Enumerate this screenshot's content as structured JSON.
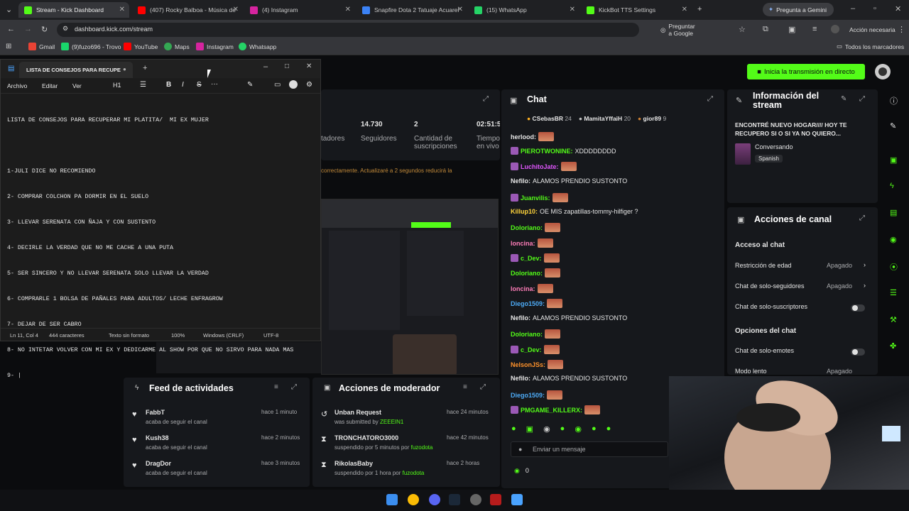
{
  "tabs": [
    {
      "label": "Stream - Kick Dashboard",
      "color": "#53fc18"
    },
    {
      "label": "(407) Rocky Balboa - Música de",
      "color": "#ff0000"
    },
    {
      "label": "(4) Instagram",
      "color": "#d6249f"
    },
    {
      "label": "Snapfire Dota 2 Tatuaje Acuarel",
      "color": "#3b82f6"
    },
    {
      "label": "(15) WhatsApp",
      "color": "#25d366"
    },
    {
      "label": "KickBot TTS Settings",
      "color": "#53fc18"
    }
  ],
  "gemini_label": "Pregunta a Gemini",
  "url": "dashboard.kick.com/stream",
  "ask_google": "Preguntar a Google",
  "action_needed": "Acción necesaria",
  "bookmarks": [
    "Gmail",
    "(9)fuzo696 - Trovo",
    "YouTube",
    "Maps",
    "Instagram",
    "Whatsapp"
  ],
  "all_bookmarks": "Todos los marcadores",
  "notepad": {
    "tab_title": "LISTA DE CONSEJOS PARA RECUPE",
    "menu": [
      "Archivo",
      "Editar",
      "Ver"
    ],
    "heading_style": "H1",
    "lines": [
      "LISTA DE CONSEJOS PARA RECUPERAR MI PLATITA/  MI EX MUJER",
      "",
      "1-JULI DICE NO RECOMIENDO",
      "2- COMPRAR COLCHON PA DORMIR EN EL SUELO",
      "3- LLEVAR SERENATA CON ÑAJA Y CON SUSTENTO",
      "4- DECIRLE LA VERDAD QUE NO ME CACHE A UNA PUTA",
      "5- SER SINCERO Y NO LLEVAR SERENATA SOLO LLEVAR LA VERDAD",
      "6- COMPRARLE 1 BOLSA DE PAÑALES PARA ADULTOS/ LECHE ENFRAGROW",
      "7- DEJAR DE SER CABRO",
      "8- NO INTETAR VOLVER CON MI EX Y DEDICARME AL SHOW POR QUE NO SIRVO PARA NADA MAS",
      "9- |"
    ],
    "status": [
      "Ln 11, Col 4",
      "444 caracteres",
      "Texto sin formato",
      "100%",
      "Windows (CRLF)",
      "UTF-8"
    ]
  },
  "go_live": "Inicia la transmisión en directo",
  "stats": {
    "col_label": "tadores",
    "followers_value": "14.730",
    "followers_label": "Seguidores",
    "subs_value": "2",
    "subs_label": "Cantidad de suscripciones",
    "time_value": "02:51:5",
    "time_label": "Tiempo en vivo"
  },
  "notice": "correctamente. Actualizaré a 2 segundos reducirá la",
  "chat": {
    "title": "Chat",
    "top": [
      {
        "name": "CSebasBR",
        "n": "24"
      },
      {
        "name": "MamitaYffaiH",
        "n": "20"
      },
      {
        "name": "gior89",
        "n": "9"
      }
    ],
    "messages": [
      {
        "user": "herlood:",
        "color": "#e6e6e6",
        "text": "",
        "emote": true
      },
      {
        "user": "PIEROTWONINE:",
        "color": "#53fc18",
        "text": "XDDDDDDDD",
        "emote": false
      },
      {
        "user": "LuchitoJate:",
        "color": "#e056fd",
        "text": "",
        "emote": true
      },
      {
        "user": "Nefilo:",
        "color": "#e6e6e6",
        "text": "ALAMOS PRENDIO SUSTONTO",
        "emote": false
      },
      {
        "user": "Juanvilis:",
        "color": "#53fc18",
        "text": "",
        "emote": true
      },
      {
        "user": "Killup10:",
        "color": "#ffd43b",
        "text": "OE MIS zapatillas-tommy-hilfiger ?",
        "emote": false
      },
      {
        "user": "Doloriano:",
        "color": "#53fc18",
        "text": "",
        "emote": true
      },
      {
        "user": "loncina:",
        "color": "#ff7eb9",
        "text": "",
        "emote": true
      },
      {
        "user": "c_Dev:",
        "color": "#53fc18",
        "text": "",
        "emote": true
      },
      {
        "user": "Doloriano:",
        "color": "#53fc18",
        "text": "",
        "emote": true
      },
      {
        "user": "loncina:",
        "color": "#ff7eb9",
        "text": "",
        "emote": true
      },
      {
        "user": "Diego1509:",
        "color": "#4dabf7",
        "text": "",
        "emote": true
      },
      {
        "user": "Nefilo:",
        "color": "#e6e6e6",
        "text": "ALAMOS PRENDIO SUSTONTO",
        "emote": false
      },
      {
        "user": "Doloriano:",
        "color": "#53fc18",
        "text": "",
        "emote": true
      },
      {
        "user": "c_Dev:",
        "color": "#53fc18",
        "text": "",
        "emote": true
      },
      {
        "user": "NelsonJSs:",
        "color": "#ff922b",
        "text": "",
        "emote": true
      },
      {
        "user": "Nefilo:",
        "color": "#e6e6e6",
        "text": "ALAMOS PRENDIO SUSTONTO",
        "emote": false
      },
      {
        "user": "Diego1509:",
        "color": "#4dabf7",
        "text": "",
        "emote": true
      },
      {
        "user": "PMGAME_KILLERX:",
        "color": "#53fc18",
        "text": "",
        "emote": true
      }
    ],
    "placeholder": "Enviar un mensaje",
    "count": "0"
  },
  "info": {
    "title": "Información del stream",
    "stream_title": "ENCONTRÉ NUEVO HOGAR//// HOY TE RECUPERO SI O SI YA NO QUIERO...",
    "category": "Conversando",
    "language": "Spanish"
  },
  "channel": {
    "title": "Acciones de canal",
    "chat_access": "Acceso al chat",
    "rows": [
      {
        "label": "Restricción de edad",
        "value": "Apagado"
      },
      {
        "label": "Chat de solo-seguidores",
        "value": "Apagado"
      },
      {
        "label": "Chat de solo-suscriptores",
        "value": ""
      }
    ],
    "chat_options": "Opciones del chat",
    "rows2": [
      {
        "label": "Chat de solo-emotes",
        "value": ""
      },
      {
        "label": "Modo lento",
        "value": "Apagado"
      }
    ]
  },
  "feed": {
    "title": "Feed de actividades",
    "items": [
      {
        "name": "FabbT",
        "action": "acaba de seguir el canal",
        "time": "hace 1 minuto"
      },
      {
        "name": "Kush38",
        "action": "acaba de seguir el canal",
        "time": "hace 2 minutos"
      },
      {
        "name": "DragDor",
        "action": "acaba de seguir el canal",
        "time": "hace 3 minutos"
      }
    ]
  },
  "mod": {
    "title": "Acciones de moderador",
    "items": [
      {
        "name": "Unban Request",
        "pre": "was submitted by ",
        "who": "ZEEEIN1",
        "time": "hace 24 minutos"
      },
      {
        "name": "TRONCHATORO3000",
        "pre": "suspendido por 5 minutos por ",
        "who": "fuzodota",
        "time": "hace 42 minutos"
      },
      {
        "name": "RikolasBaby",
        "pre": "suspendido por 1 hora por ",
        "who": "fuzodota",
        "time": "hace 2 horas"
      }
    ]
  }
}
